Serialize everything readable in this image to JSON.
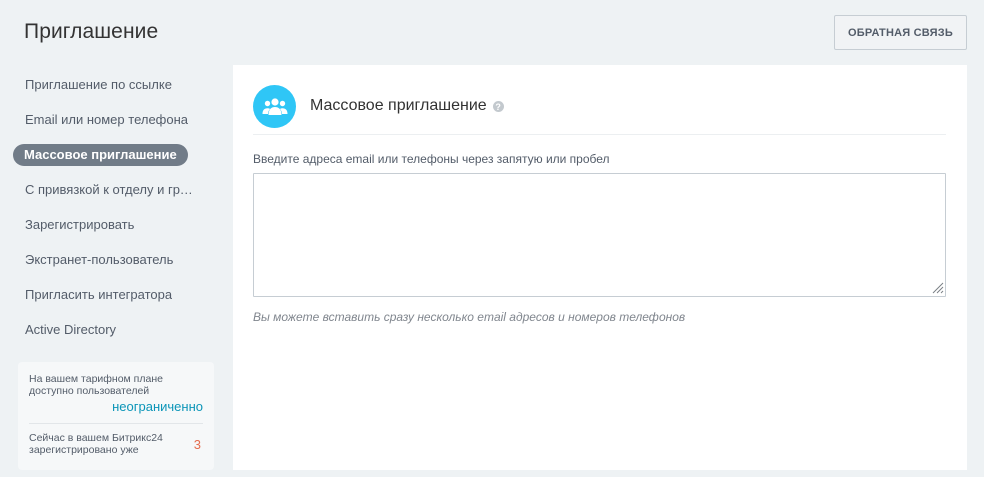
{
  "header": {
    "title": "Приглашение",
    "feedback_label": "Обратная связь"
  },
  "sidebar": {
    "items": [
      {
        "label": "Приглашение по ссылке",
        "active": false
      },
      {
        "label": "Email или номер телефона",
        "active": false
      },
      {
        "label": "Массовое приглашение",
        "active": true
      },
      {
        "label": "С привязкой к отделу и группам",
        "active": false
      },
      {
        "label": "Зарегистрировать",
        "active": false
      },
      {
        "label": "Экстранет-пользователь",
        "active": false
      },
      {
        "label": "Пригласить интегратора",
        "active": false
      },
      {
        "label": "Active Directory",
        "active": false
      }
    ]
  },
  "tariff": {
    "available_label": "На вашем тарифном плане доступно пользователей",
    "available_value": "неограниченно",
    "registered_label": "Сейчас в вашем Битрикс24 зарегистрировано уже",
    "registered_value": "3"
  },
  "main": {
    "icon": "users-group-icon",
    "title": "Массовое приглашение",
    "field_label": "Введите адреса email или телефоны через запятую или пробел",
    "textarea_value": "",
    "hint": "Вы можете вставить сразу несколько email адресов и номеров телефонов"
  },
  "colors": {
    "background": "#eef2f4",
    "active_item": "#717c88",
    "icon_accent": "#2fc6f6",
    "unlimited_value": "#0b95b8",
    "count_value": "#e56d4f"
  }
}
